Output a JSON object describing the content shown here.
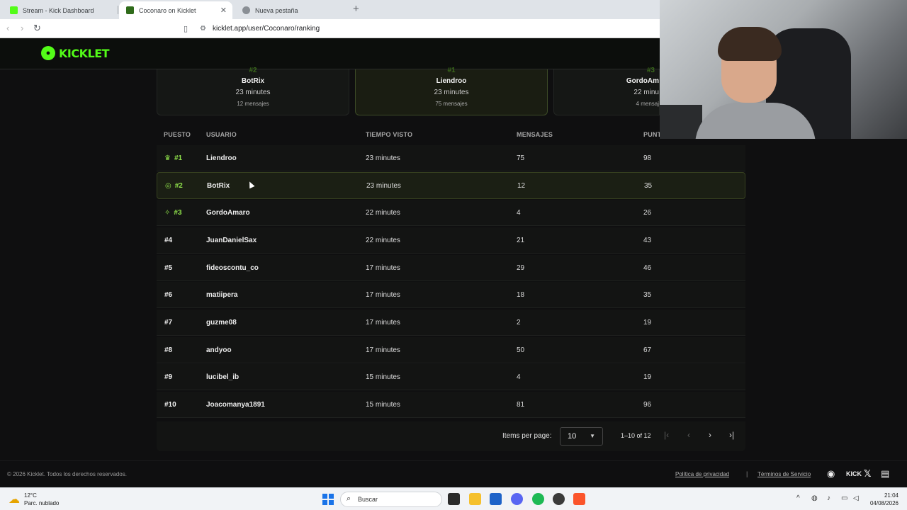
{
  "browser": {
    "tabs": [
      {
        "title": "Stream - Kick Dashboard"
      },
      {
        "title": "Coconaro on Kicklet"
      },
      {
        "title": "Nueva pestaña"
      }
    ],
    "url": "kicklet.app/user/Coconaro/ranking"
  },
  "site": {
    "logo_text": "KICKLET"
  },
  "podium": [
    {
      "rank": "#2",
      "name": "BotRix",
      "time": "23 minutes",
      "messages": "12 mensajes"
    },
    {
      "rank": "#1",
      "name": "Liendroo",
      "time": "23 minutes",
      "messages": "75 mensajes"
    },
    {
      "rank": "#3",
      "name": "GordoAm",
      "time": "22 minu",
      "messages": "4 mensaj"
    }
  ],
  "table": {
    "headers": {
      "rank": "PUESTO",
      "user": "USUARIO",
      "time": "TIEMPO VISTO",
      "messages": "MENSAJES",
      "points": "PUNT"
    },
    "rows": [
      {
        "rank": "#1",
        "user": "Liendroo",
        "time": "23 minutes",
        "messages": "75",
        "points": "98"
      },
      {
        "rank": "#2",
        "user": "BotRix",
        "time": "23 minutes",
        "messages": "12",
        "points": "35"
      },
      {
        "rank": "#3",
        "user": "GordoAmaro",
        "time": "22 minutes",
        "messages": "4",
        "points": "26"
      },
      {
        "rank": "#4",
        "user": "JuanDanielSax",
        "time": "22 minutes",
        "messages": "21",
        "points": "43"
      },
      {
        "rank": "#5",
        "user": "fideoscontu_co",
        "time": "17 minutes",
        "messages": "29",
        "points": "46"
      },
      {
        "rank": "#6",
        "user": "matiipera",
        "time": "17 minutes",
        "messages": "18",
        "points": "35"
      },
      {
        "rank": "#7",
        "user": "guzme08",
        "time": "17 minutes",
        "messages": "2",
        "points": "19"
      },
      {
        "rank": "#8",
        "user": "andyoo",
        "time": "17 minutes",
        "messages": "50",
        "points": "67"
      },
      {
        "rank": "#9",
        "user": "lucibel_ib",
        "time": "15 minutes",
        "messages": "4",
        "points": "19"
      },
      {
        "rank": "#10",
        "user": "Joacomanya1891",
        "time": "15 minutes",
        "messages": "81",
        "points": "96"
      }
    ]
  },
  "pagination": {
    "items_per_page_label": "Items per page:",
    "items_per_page_value": "10",
    "range": "1–10 of 12"
  },
  "footer": {
    "copyright": "© 2026 Kicklet. Todos los derechos reservados.",
    "privacy": "Política de privacidad",
    "separator": "|",
    "terms": "Términos de Servicio",
    "kick_label": "KICK"
  },
  "taskbar": {
    "temp": "12°C",
    "weather": "Parc. nublado",
    "search_placeholder": "Buscar",
    "time": "21:04",
    "date": "04/08/2026"
  },
  "colors": {
    "accent": "#53fc18",
    "rank_top": "#8ee04a",
    "background": "#0f0f10"
  }
}
